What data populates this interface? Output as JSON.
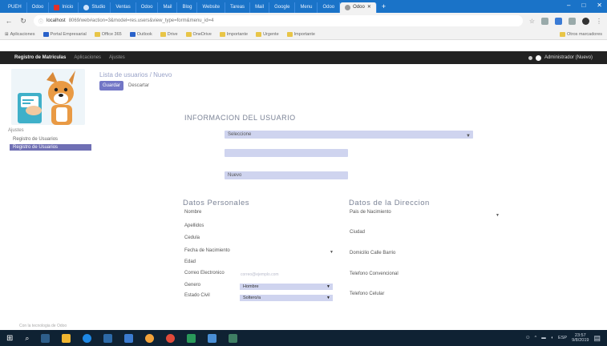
{
  "browser": {
    "tabs": [
      "PUEH",
      "Odoo",
      "Inicio",
      "Studio",
      "Ventas",
      "Odoo",
      "Mail",
      "Blog",
      "Website",
      "Tareas",
      "Mail",
      "Google",
      "Menu",
      "Odoo",
      "Odoo"
    ],
    "new_tab": "+",
    "window_controls": [
      "–",
      "□",
      "✕"
    ],
    "address": {
      "host": "localhost",
      "path": "8069/web#action=3&model=res.users&view_type=form&menu_id=4"
    },
    "bookmarks": [
      "Aplicaciones",
      "Portal Empresarial",
      "Office 365",
      "Outlook",
      "Drive",
      "OneDrive",
      "Importante",
      "Urgente",
      "Importante"
    ],
    "bookmarks_right": "Otros marcadores"
  },
  "appbar": {
    "brand": "Registro de Matriculas",
    "menu1": "Aplicaciones",
    "menu2": "Ajustes",
    "user": "Administrador (Nuevo)"
  },
  "sidebar": {
    "heading": "Ajustes",
    "items": [
      "Registro de Usuarios",
      "Registro de Usuarios"
    ]
  },
  "page": {
    "breadcrumb": "Lista de usuarios / Nuevo",
    "save_label": "Guardar",
    "discard_label": "Descartar"
  },
  "form": {
    "section_user": "INFORMACION DEL USUARIO",
    "field_user_placeholder": "Seleccione",
    "field_password_value": "",
    "field_profile_value": "Nuevo",
    "section_personal": "Datos Personales",
    "section_address": "Datos de la Direccion",
    "personal_labels": [
      "Nombre",
      "Apellidos",
      "Cedula",
      "Fecha de Nacimiento",
      "Edad",
      "Correo Electronico",
      "Genero",
      "Estado Civil"
    ],
    "email_hint": "correo@ejemplo.com",
    "genero_value": "Hombre",
    "estado_civil_value": "Soltero/a",
    "address_labels": [
      "Pais de Nacimiento",
      "Ciudad",
      "Domicilio Calle Barrio",
      "Telefono Convencional",
      "Telefono Celular"
    ]
  },
  "footer": "Con la tecnologia de Odoo",
  "taskbar": {
    "tray_lang": "ESP",
    "time": "23:57",
    "date": "9/8/2019"
  },
  "colors": {
    "accent": "#7276c6",
    "field_bg": "#cfd4ef",
    "navbar": "#222222",
    "tabstrip": "#1a73c8",
    "taskbar": "#0f2233"
  }
}
